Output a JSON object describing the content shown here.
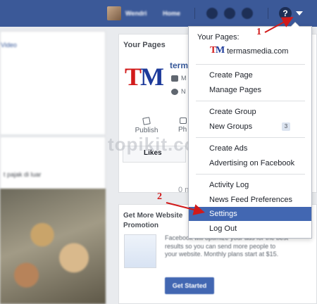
{
  "topbar": {
    "user_name": "Wendri",
    "home_label": "Home",
    "help_glyph": "?",
    "icons": [
      "friends-icon",
      "messages-icon",
      "notifications-icon",
      "help-icon",
      "account-caret-icon"
    ]
  },
  "left": {
    "link_text": "Video",
    "caption": "t pajak di luar"
  },
  "your_pages_card": {
    "heading": "Your Pages",
    "logo_t": "T",
    "logo_m": "M",
    "page_name": "term",
    "meta_1": "M",
    "meta_2": "N",
    "publish_label": "Publish",
    "photo_label": "Ph",
    "likes_tab": "Likes",
    "new_count": "0 ne"
  },
  "promotion": {
    "heading": "Get More Website Promotion",
    "text": "Facebook will optimize your ads for the best results so you can send more people to your website. Monthly plans start at $15.",
    "button_label": "Get Started"
  },
  "watermark": "topikit.com",
  "menu": {
    "your_pages_label": "Your Pages:",
    "page_name": "termasmedia.com",
    "items_group1": [
      "Create Page",
      "Manage Pages"
    ],
    "items_group2": [
      "Create Group",
      "New Groups"
    ],
    "new_groups_badge": "3",
    "items_group3": [
      "Create Ads",
      "Advertising on Facebook"
    ],
    "items_group4": [
      "Activity Log",
      "News Feed Preferences",
      "Settings",
      "Log Out"
    ],
    "active_item": "Settings"
  },
  "annotations": {
    "step1": "1",
    "step2": "2",
    "color": "#d11a1a"
  },
  "colors": {
    "topbar": "#3b5998",
    "highlight": "#4267b2",
    "link": "#365899"
  }
}
